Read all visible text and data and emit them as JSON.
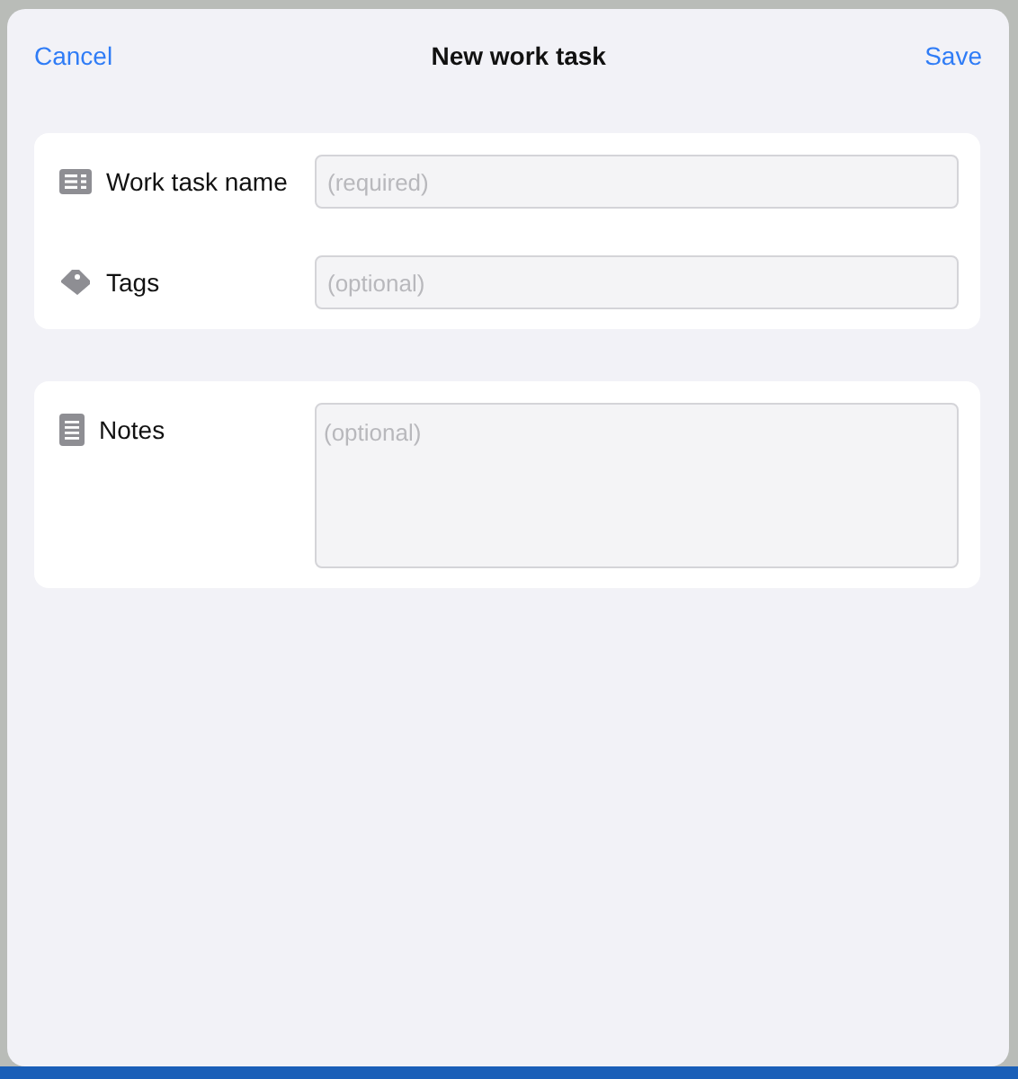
{
  "navigation_bar": {
    "cancel": "Cancel",
    "title": "New work task",
    "save": "Save"
  },
  "sections": [
    {
      "fields": [
        {
          "kind": "text",
          "label": "Work task name",
          "placeholder": "(required)"
        },
        {
          "kind": "text",
          "label": "Tags",
          "placeholder": "(optional)"
        }
      ]
    },
    {
      "fields": [
        {
          "kind": "textarea",
          "label": "Notes",
          "placeholder": "(optional)"
        }
      ]
    }
  ]
}
